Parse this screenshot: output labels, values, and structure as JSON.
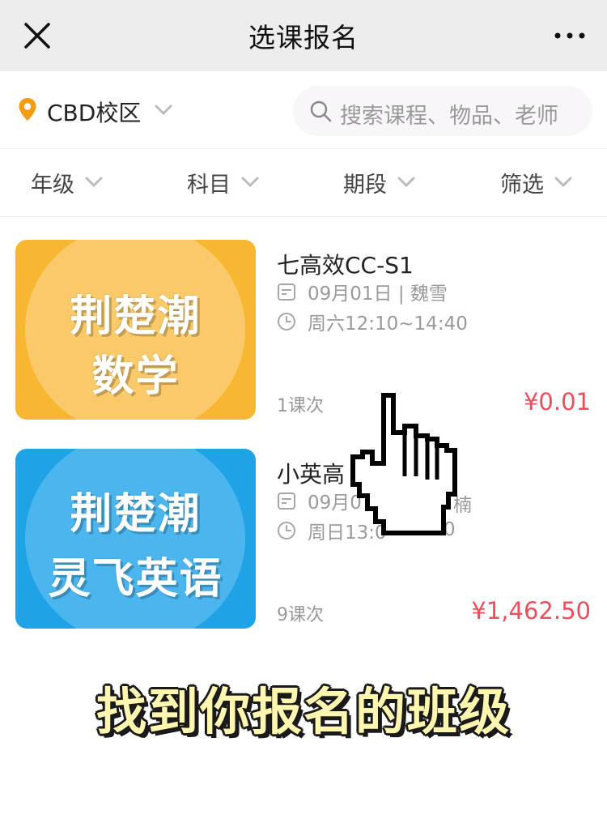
{
  "titlebar": {
    "title": "选课报名",
    "close_icon": "close-icon",
    "more_icon": "more-dots-icon"
  },
  "location": {
    "campus": "CBD校区",
    "icon": "location-pin-icon",
    "accent_color": "#f39c12"
  },
  "search": {
    "placeholder": "搜索课程、物品、老师",
    "icon": "search-icon"
  },
  "filters": [
    {
      "label": "年级"
    },
    {
      "label": "科目"
    },
    {
      "label": "期段"
    },
    {
      "label": "筛选"
    }
  ],
  "courses": [
    {
      "thumb_line1": "荆楚潮",
      "thumb_line2": "数学",
      "thumb_bg": "#f7b731",
      "thumb_circle": "#f9c96a",
      "title": "七高效CC-S1",
      "date_teacher": "09月01日 | 魏雪",
      "schedule": "周六12:10~14:40",
      "sessions": "1课次",
      "price": "¥0.01"
    },
    {
      "thumb_line1": "荆楚潮",
      "thumb_line2": "灵飞英语",
      "thumb_bg": "#1fa2e6",
      "thumb_circle": "#4bb5ee",
      "title": "小英高",
      "date_teacher": "09月0",
      "date_teacher_tail": "楠",
      "schedule": "周日13:0",
      "schedule_tail": "0",
      "sessions": "9课次",
      "price": "¥1,462.50"
    }
  ],
  "caption": "找到你报名的班级",
  "price_color": "#e8505b"
}
